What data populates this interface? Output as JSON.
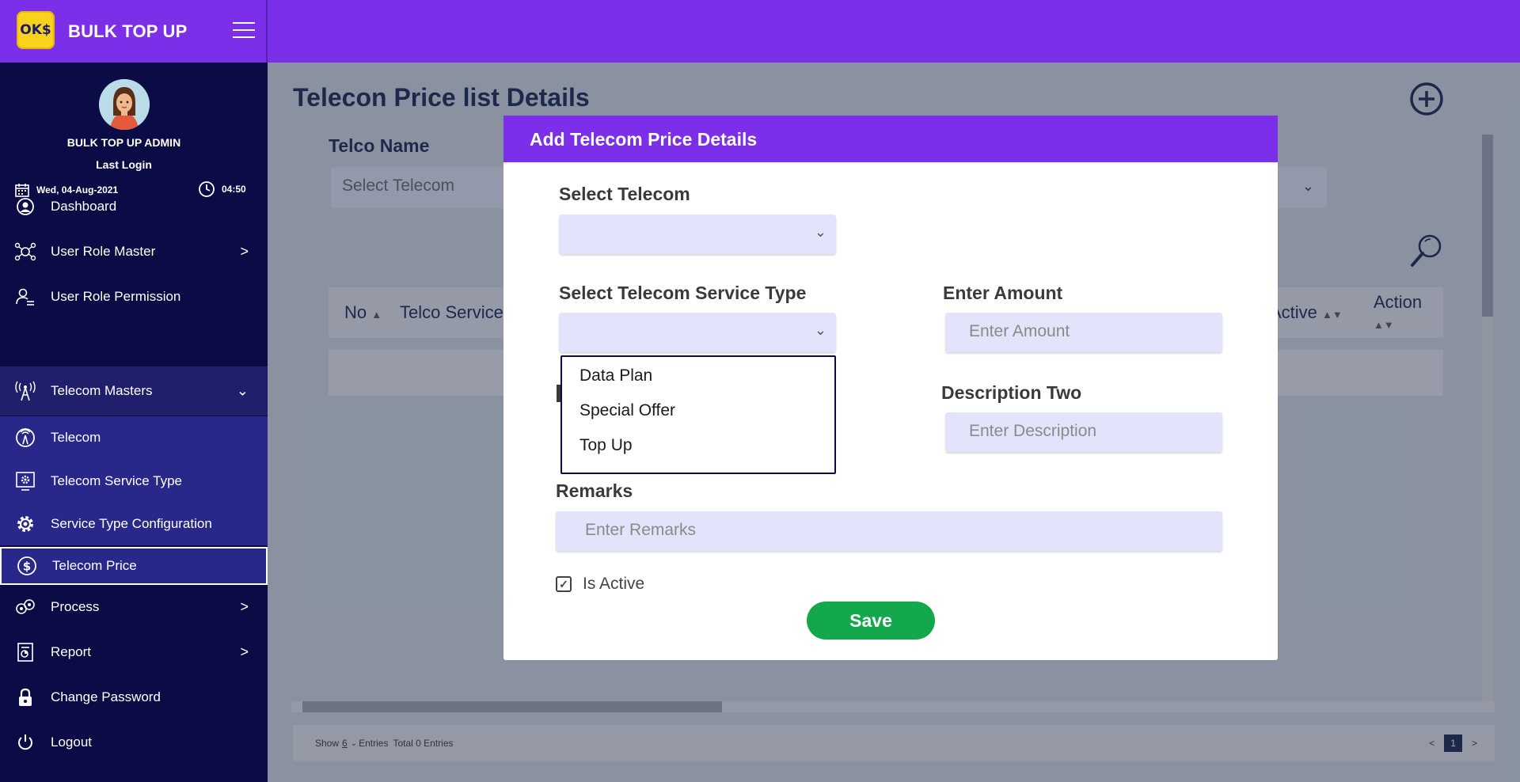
{
  "brand": {
    "title": "BULK TOP UP",
    "logo_text": "OK$"
  },
  "user": {
    "name": "BULK TOP UP ADMIN",
    "last_login_label": "Last Login",
    "login_date": "Wed, 04-Aug-2021",
    "login_time": "04:50"
  },
  "sidebar": {
    "items": [
      {
        "label": "Dashboard",
        "icon": "user-circle-icon"
      },
      {
        "label": "User Role Master",
        "icon": "network-user-icon",
        "chevron": ">"
      },
      {
        "label": "User Role Permission",
        "icon": "user-list-icon"
      },
      {
        "label": "Telecom Masters",
        "icon": "antenna-icon",
        "chevron": "⌵"
      },
      {
        "label": "Telecom",
        "icon": "signal-circle-icon"
      },
      {
        "label": "Telecom Service Type",
        "icon": "gear-screen-icon"
      },
      {
        "label": "Service Type Configuration",
        "icon": "gear-icon"
      },
      {
        "label": "Telecom Price",
        "icon": "dollar-circle-icon"
      },
      {
        "label": "Process",
        "icon": "process-icon",
        "chevron": ">"
      },
      {
        "label": "Report",
        "icon": "report-icon",
        "chevron": ">"
      },
      {
        "label": "Change Password",
        "icon": "lock-icon"
      },
      {
        "label": "Logout",
        "icon": "power-icon"
      }
    ]
  },
  "main": {
    "title": "Telecon Price list Details",
    "telco_label": "Telco Name",
    "telco_placeholder": "Select Telecom",
    "table": {
      "columns": [
        "No",
        "Telco Service",
        "Active",
        "Action"
      ]
    },
    "footer": {
      "show_label": "Show",
      "show_value": "6",
      "entries_label": "Entries",
      "total_label": "Total 0 Entries",
      "page": "1",
      "prev": "<",
      "next": ">"
    }
  },
  "modal": {
    "title": "Add Telecom Price Details",
    "select_telecom_label": "Select Telecom",
    "service_type_label": "Select Telecom Service Type",
    "service_type_options": [
      "Data Plan",
      "Special Offer",
      "Top Up"
    ],
    "amount_label": "Enter Amount",
    "amount_placeholder": "Enter Amount",
    "description_two_label": "Description Two",
    "description_placeholder": "Enter Description",
    "remarks_label": "Remarks",
    "remarks_placeholder": "Enter Remarks",
    "is_active_label": "Is Active",
    "is_active_checked": true,
    "save_label": "Save"
  },
  "colors": {
    "brand_purple": "#7b2fe8",
    "sidebar_navy": "#0b0c45",
    "save_green": "#12a84b",
    "input_lavender": "#e3e3fb"
  }
}
